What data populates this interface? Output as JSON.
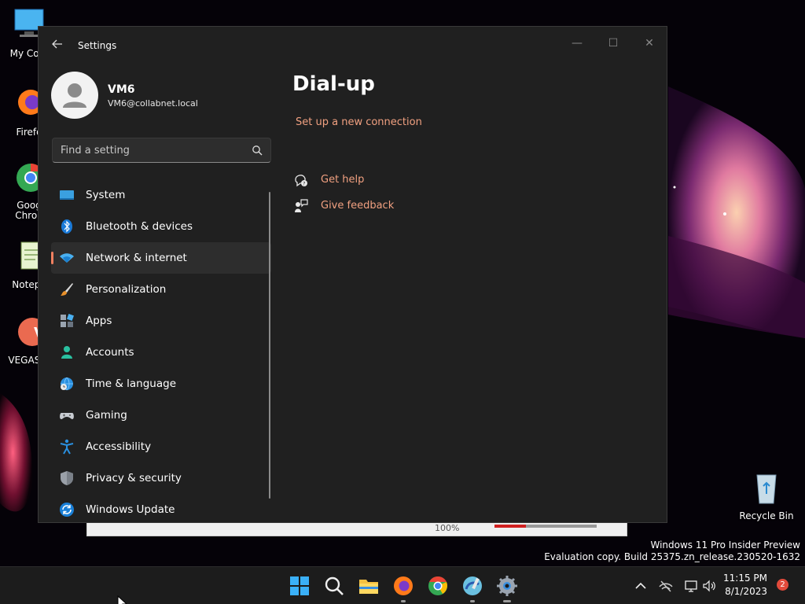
{
  "desktop": {
    "icons": [
      {
        "label": "My Com"
      },
      {
        "label": "Firefo"
      },
      {
        "label": "Goog\nChron"
      },
      {
        "label": "Notepa"
      },
      {
        "label": "VEGAS Ir"
      },
      {
        "label": "Recycle Bin"
      }
    ],
    "watermark_line1": "Windows 11 Pro Insider Preview",
    "watermark_line2": "Evaluation copy. Build 25375.zn_release.230520-1632"
  },
  "background_app": {
    "zoom": "100%"
  },
  "window": {
    "title": "Settings",
    "minimize": "—",
    "maximize": "☐",
    "close": "✕"
  },
  "profile": {
    "name": "VM6",
    "email": "VM6@collabnet.local"
  },
  "search": {
    "placeholder": "Find a setting"
  },
  "nav": {
    "items": [
      {
        "label": "System",
        "icon": "system-icon"
      },
      {
        "label": "Bluetooth & devices",
        "icon": "bluetooth-icon"
      },
      {
        "label": "Network & internet",
        "icon": "wifi-icon",
        "active": true
      },
      {
        "label": "Personalization",
        "icon": "brush-icon"
      },
      {
        "label": "Apps",
        "icon": "apps-icon"
      },
      {
        "label": "Accounts",
        "icon": "person-icon"
      },
      {
        "label": "Time & language",
        "icon": "globe-clock-icon"
      },
      {
        "label": "Gaming",
        "icon": "gamepad-icon"
      },
      {
        "label": "Accessibility",
        "icon": "accessibility-icon"
      },
      {
        "label": "Privacy & security",
        "icon": "shield-icon"
      },
      {
        "label": "Windows Update",
        "icon": "update-icon"
      }
    ]
  },
  "content": {
    "title": "Dial-up",
    "setup_link": "Set up a new connection",
    "get_help": "Get help",
    "give_feedback": "Give feedback"
  },
  "taskbar": {
    "time": "11:15 PM",
    "date": "8/1/2023",
    "notifications": "2"
  },
  "colors": {
    "accent": "#f0a080",
    "window_bg": "#202020",
    "taskbar_bg": "#1c1c1c"
  }
}
